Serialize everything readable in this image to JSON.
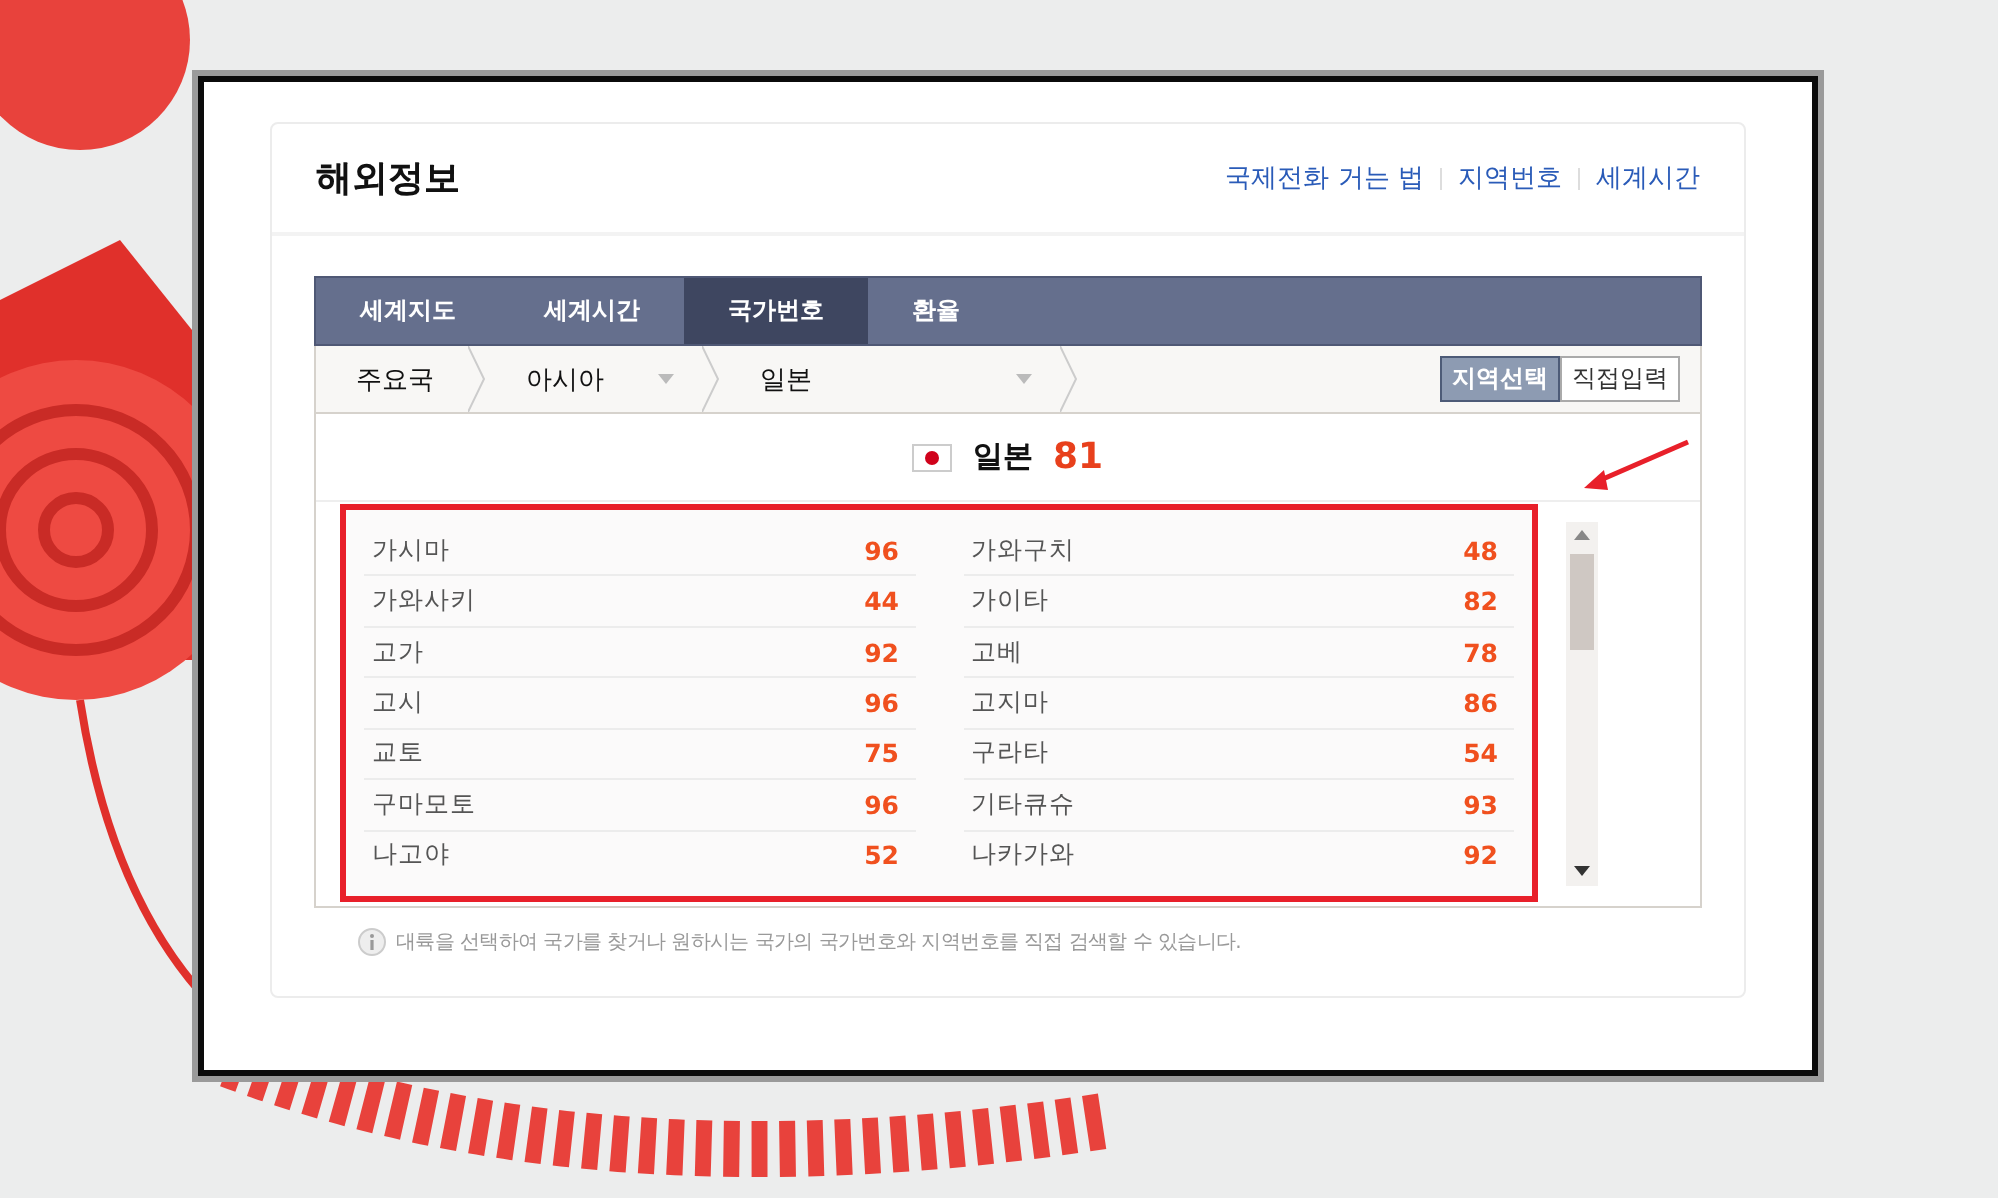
{
  "header": {
    "title": "해외정보",
    "links": [
      "국제전화 거는 법",
      "지역번호",
      "세계시간"
    ]
  },
  "tabs": [
    {
      "label": "세계지도",
      "selected": false
    },
    {
      "label": "세계시간",
      "selected": false
    },
    {
      "label": "국가번호",
      "selected": true
    },
    {
      "label": "환율",
      "selected": false
    }
  ],
  "breadcrumb": [
    {
      "label": "주요국",
      "kind": "plain"
    },
    {
      "label": "아시아",
      "kind": "dropdown"
    },
    {
      "label": "일본",
      "kind": "dropdown"
    }
  ],
  "mode_buttons": [
    {
      "label": "지역선택",
      "selected": true
    },
    {
      "label": "직접입력",
      "selected": false
    }
  ],
  "country": {
    "name": "일본",
    "code": "81"
  },
  "columns": [
    [
      {
        "city": "가시마",
        "code": "96"
      },
      {
        "city": "가와사키",
        "code": "44"
      },
      {
        "city": "고가",
        "code": "92"
      },
      {
        "city": "고시",
        "code": "96"
      },
      {
        "city": "교토",
        "code": "75"
      },
      {
        "city": "구마모토",
        "code": "96"
      },
      {
        "city": "나고야",
        "code": "52"
      }
    ],
    [
      {
        "city": "가와구치",
        "code": "48"
      },
      {
        "city": "가이타",
        "code": "82"
      },
      {
        "city": "고베",
        "code": "78"
      },
      {
        "city": "고지마",
        "code": "86"
      },
      {
        "city": "구라타",
        "code": "54"
      },
      {
        "city": "기타큐슈",
        "code": "93"
      },
      {
        "city": "나카가와",
        "code": "92"
      }
    ]
  ],
  "note": "대륙을 선택하여 국가를 찾거나 원하시는 국가의 국가번호와 지역번호를 직접 검색할 수 있습니다."
}
